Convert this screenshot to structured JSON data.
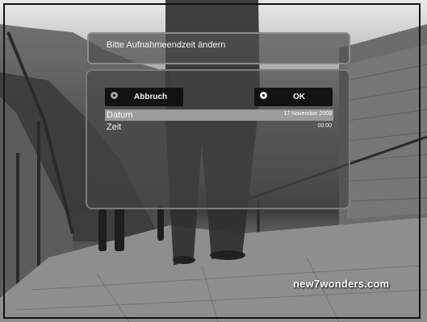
{
  "dialog": {
    "title": "Bitte Aufnahmeendzeit ändern",
    "buttons": {
      "cancel_label": "Abbruch",
      "ok_label": "OK"
    },
    "fields": [
      {
        "label": "Datum",
        "value": "17 November 2009"
      },
      {
        "label": "Zeit",
        "value": "00:00"
      }
    ]
  },
  "watermark": "new7wonders.com"
}
